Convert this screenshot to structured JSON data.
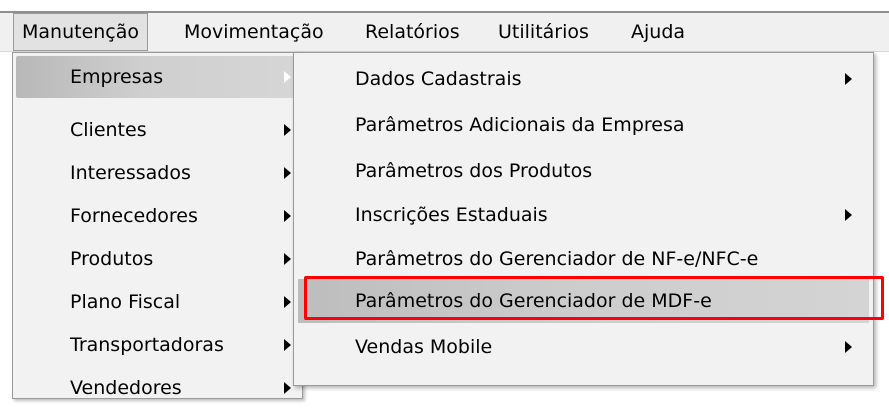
{
  "menubar": {
    "items": [
      {
        "label": "Manutenção"
      },
      {
        "label": "Movimentação"
      },
      {
        "label": "Relatórios"
      },
      {
        "label": "Utilitários"
      },
      {
        "label": "Ajuda"
      }
    ]
  },
  "menu1": {
    "items": [
      {
        "label": "Empresas"
      },
      {
        "label": "Clientes"
      },
      {
        "label": "Interessados"
      },
      {
        "label": "Fornecedores"
      },
      {
        "label": "Produtos"
      },
      {
        "label": "Plano Fiscal"
      },
      {
        "label": "Transportadoras"
      },
      {
        "label": "Vendedores"
      }
    ]
  },
  "menu2": {
    "items": [
      {
        "label": "Dados Cadastrais"
      },
      {
        "label": "Parâmetros Adicionais da Empresa"
      },
      {
        "label": "Parâmetros dos Produtos"
      },
      {
        "label": "Inscrições Estaduais"
      },
      {
        "label": "Parâmetros do Gerenciador de NF-e/NFC-e"
      },
      {
        "label": "Parâmetros do Gerenciador de MDF-e"
      },
      {
        "label": "Vendas Mobile"
      }
    ]
  },
  "colors": {
    "highlight_box": "#ff0000",
    "menu_background": "#f2f2f2",
    "selected_item": "#c8c8c8"
  }
}
